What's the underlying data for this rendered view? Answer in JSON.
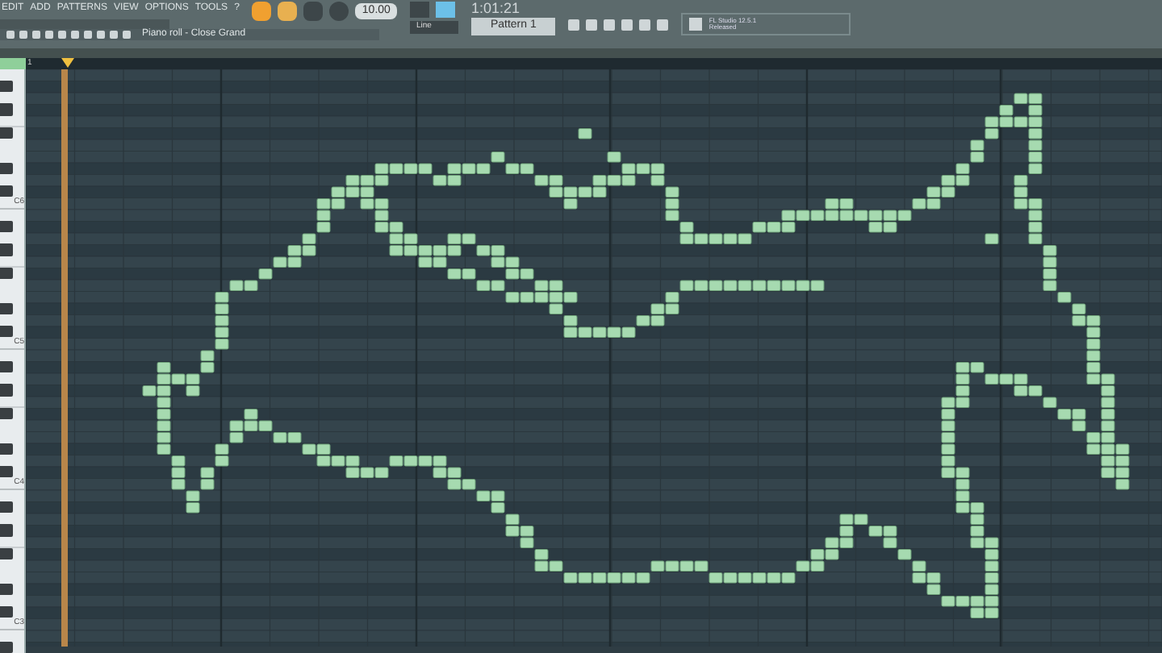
{
  "menu": [
    "EDIT",
    "ADD",
    "PATTERNS",
    "VIEW",
    "OPTIONS",
    "TOOLS",
    "?"
  ],
  "tempo": "10.00",
  "time": "1:01:21",
  "snap": "Line",
  "pattern": "Pattern 1",
  "news": {
    "title": "FL Studio 12.5.1",
    "subtitle": "Released"
  },
  "piano_roll": {
    "title": "Piano roll - Close Grand",
    "ruler": [
      "1"
    ],
    "keys": [
      "C6",
      "C5",
      "C4",
      "C3"
    ]
  }
}
